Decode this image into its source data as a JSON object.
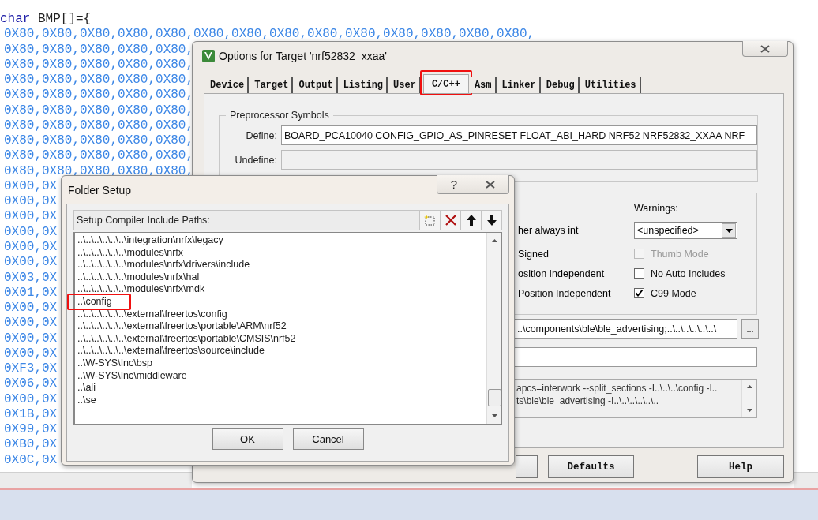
{
  "editor": {
    "declaration": {
      "keyword": "char",
      "text": " BMP[]={"
    },
    "lines": [
      "0X80,0X80,0X80,0X80,0X80,0X80,0X80,0X80,0X80,0X80,0X80,0X80,0X80,0X80,",
      "0X80,0X80,0X80,0X80,0X80,",
      "0X80,0X80,0X80,0X80,0X80,",
      "0X80,0X80,0X80,0X80,0X80,",
      "0X80,0X80,0X80,0X80,0X80,",
      "0X80,0X80,0X80,0X80,0X80,",
      "0X80,0X80,0X80,0X80,0X80,",
      "0X80,0X80,0X80,0X80,0X80,",
      "0X80,0X80,0X80,0X80,0X80,",
      "0X80,0X80,0X80,0X80,0X80,",
      "0X00,0X",
      "0X00,0X",
      "0X00,0X",
      "0X00,0X",
      "0X00,0X",
      "0X00,0X",
      "0X03,0X",
      "0X01,0X",
      "0X00,0X",
      "0X00,0X",
      "0X00,0X",
      "0X00,0X",
      "0XF3,0X",
      "0X06,0X",
      "0X00,0X",
      "0X1B,0X",
      "0X99,0X",
      "0XB0,0X",
      "0X0C,0X"
    ]
  },
  "options_dialog": {
    "title": "Options for Target 'nrf52832_xxaa'",
    "tabs": [
      {
        "label": "Device",
        "selected": false,
        "highlighted": false
      },
      {
        "label": "Target",
        "selected": false,
        "highlighted": false
      },
      {
        "label": "Output",
        "selected": false,
        "highlighted": false
      },
      {
        "label": "Listing",
        "selected": false,
        "highlighted": false
      },
      {
        "label": "User",
        "selected": false,
        "highlighted": false
      },
      {
        "label": "C/C++",
        "selected": true,
        "highlighted": true
      },
      {
        "label": "Asm",
        "selected": false,
        "highlighted": false
      },
      {
        "label": "Linker",
        "selected": false,
        "highlighted": false
      },
      {
        "label": "Debug",
        "selected": false,
        "highlighted": false
      },
      {
        "label": "Utilities",
        "selected": false,
        "highlighted": false
      }
    ],
    "preprocessor": {
      "title": "Preprocessor Symbols",
      "define_label": "Define:",
      "define_value": "BOARD_PCA10040 CONFIG_GPIO_AS_PINRESET FLOAT_ABI_HARD NRF52 NRF52832_XXAA NRF",
      "undefine_label": "Undefine:"
    },
    "options": [
      "her always int",
      "Signed",
      "osition Independent",
      "Position Independent"
    ],
    "warnings": {
      "label": "Warnings:",
      "value": "<unspecified>"
    },
    "checkboxes": [
      {
        "label": "Thumb Mode",
        "checked": false,
        "disabled": true
      },
      {
        "label": "No Auto Includes",
        "checked": false,
        "disabled": false
      },
      {
        "label": "C99 Mode",
        "checked": true,
        "disabled": false
      }
    ],
    "include_paths": {
      "value": "..\\components\\ble\\ble_advertising;..\\..\\..\\..\\..\\..\\",
      "button": "..."
    },
    "compiler_control": [
      "apcs=interwork --split_sections -I..\\..\\..\\config -I..",
      "ts\\ble\\ble_advertising -I..\\..\\..\\..\\..\\.."
    ],
    "buttons": [
      "Defaults",
      "Help"
    ]
  },
  "folder_setup": {
    "title": "Folder Setup",
    "help_button": "?",
    "header": "Setup Compiler Include Paths:",
    "paths": [
      {
        "text": "..\\..\\..\\..\\..\\..\\integration\\nrfx\\legacy",
        "highlighted": false
      },
      {
        "text": "..\\..\\..\\..\\..\\..\\modules\\nrfx",
        "highlighted": false
      },
      {
        "text": "..\\..\\..\\..\\..\\..\\modules\\nrfx\\drivers\\include",
        "highlighted": false
      },
      {
        "text": "..\\..\\..\\..\\..\\..\\modules\\nrfx\\hal",
        "highlighted": false
      },
      {
        "text": "..\\..\\..\\..\\..\\..\\modules\\nrfx\\mdk",
        "highlighted": false
      },
      {
        "text": "..\\config",
        "highlighted": true
      },
      {
        "text": "..\\..\\..\\..\\..\\..\\external\\freertos\\config",
        "highlighted": false
      },
      {
        "text": "..\\..\\..\\..\\..\\..\\external\\freertos\\portable\\ARM\\nrf52",
        "highlighted": false
      },
      {
        "text": "..\\..\\..\\..\\..\\..\\external\\freertos\\portable\\CMSIS\\nrf52",
        "highlighted": false
      },
      {
        "text": "..\\..\\..\\..\\..\\..\\external\\freertos\\source\\include",
        "highlighted": false
      },
      {
        "text": "..\\W-SYS\\Inc\\bsp",
        "highlighted": false
      },
      {
        "text": "..\\W-SYS\\Inc\\middleware",
        "highlighted": false
      },
      {
        "text": "..\\ali",
        "highlighted": false
      },
      {
        "text": "..\\se",
        "highlighted": false
      }
    ],
    "buttons": [
      "OK",
      "Cancel"
    ]
  }
}
